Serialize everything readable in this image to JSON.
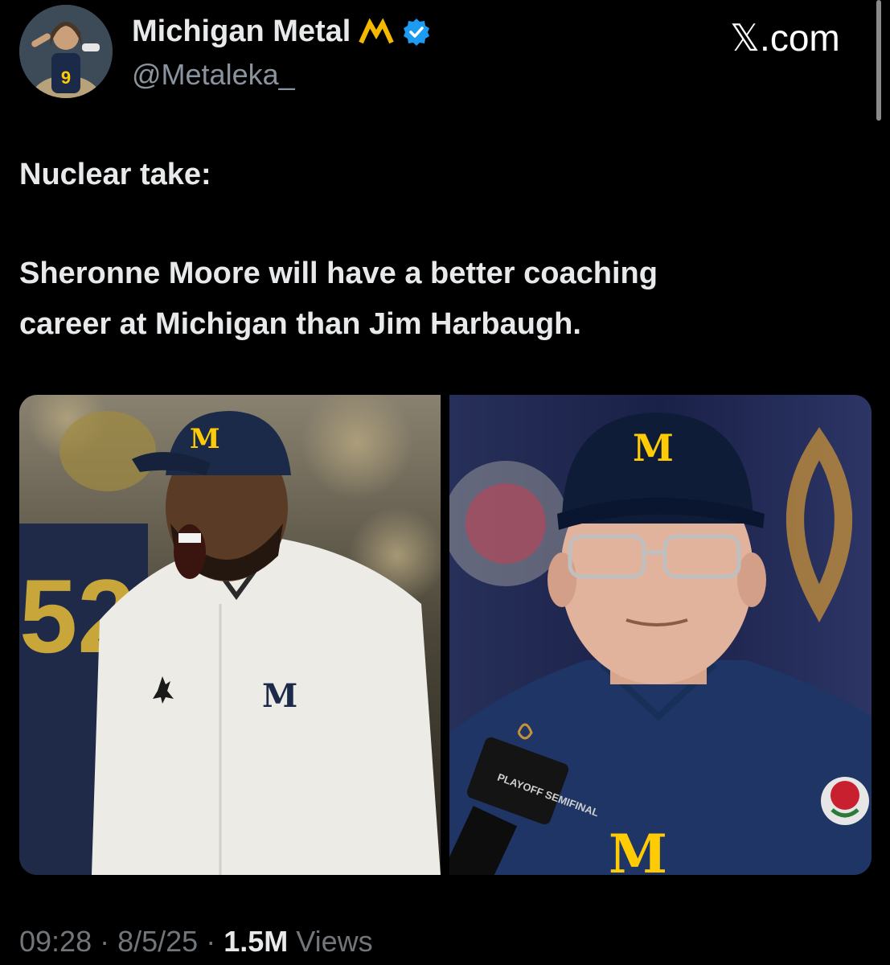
{
  "author": {
    "display_name": "Michigan Metal",
    "handle": "@Metaleka_",
    "avatar": "avatar-image",
    "name_emoji": "m-logo-icon",
    "verified": true,
    "verified_color": "#1d9bf0",
    "emoji_color": "#f5b800"
  },
  "watermark": "𝕏.com",
  "tweet": {
    "line1": "Nuclear take:",
    "line2": "Sheronne Moore will have a better coaching",
    "line3": "career at Michigan than Jim Harbaugh."
  },
  "media": {
    "left_image": "photo-sherrone-moore",
    "right_image": "photo-jim-harbaugh",
    "logo_letter": "M",
    "mic_label": "PLAYOFF SEMIFINAL",
    "jersey_number": "52"
  },
  "meta": {
    "time": "09:28",
    "sep1": " · ",
    "date": "8/5/25",
    "sep2": " · ",
    "views_count": "1.5M",
    "views_label": " Views"
  },
  "colors": {
    "background": "#000000",
    "text": "#e7e9ea",
    "muted": "#71767b",
    "maize": "#ffcb05",
    "navy": "#1c2a4a"
  }
}
